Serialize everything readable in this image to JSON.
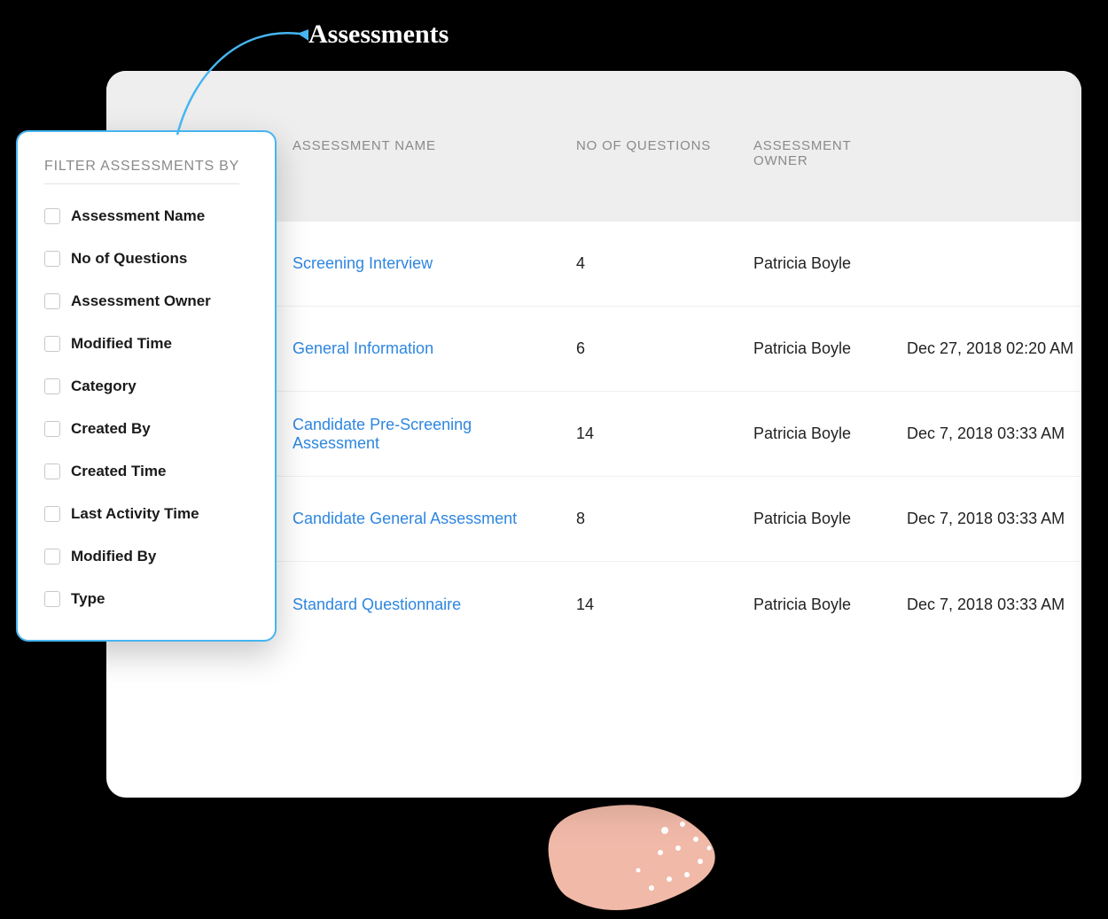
{
  "annotation": {
    "label": "Assessments"
  },
  "filter_panel": {
    "title": "FILTER ASSESSMENTS BY",
    "items": [
      {
        "label": "Assessment Name"
      },
      {
        "label": "No of Questions"
      },
      {
        "label": "Assessment Owner"
      },
      {
        "label": "Modified Time"
      },
      {
        "label": "Category"
      },
      {
        "label": "Created By"
      },
      {
        "label": "Created Time"
      },
      {
        "label": "Last Activity Time"
      },
      {
        "label": "Modified By"
      },
      {
        "label": "Type"
      }
    ]
  },
  "table": {
    "columns": {
      "name": "ASSESSMENT NAME",
      "questions": "NO OF QUESTIONS",
      "owner": "ASSESSMENT OWNER"
    },
    "rows": [
      {
        "name": "Screening Interview",
        "questions": "4",
        "owner": "Patricia Boyle",
        "time": ""
      },
      {
        "name": "General Information",
        "questions": "6",
        "owner": "Patricia Boyle",
        "time": "Dec 27, 2018 02:20 AM"
      },
      {
        "name": "Candidate Pre-Screening Assessment",
        "questions": "14",
        "owner": "Patricia Boyle",
        "time": "Dec 7, 2018 03:33 AM"
      },
      {
        "name": "Candidate General Assessment",
        "questions": "8",
        "owner": "Patricia Boyle",
        "time": "Dec 7, 2018 03:33 AM"
      },
      {
        "name": "Standard Questionnaire",
        "questions": "14",
        "owner": "Patricia Boyle",
        "time": "Dec 7, 2018 03:33 AM"
      }
    ]
  }
}
